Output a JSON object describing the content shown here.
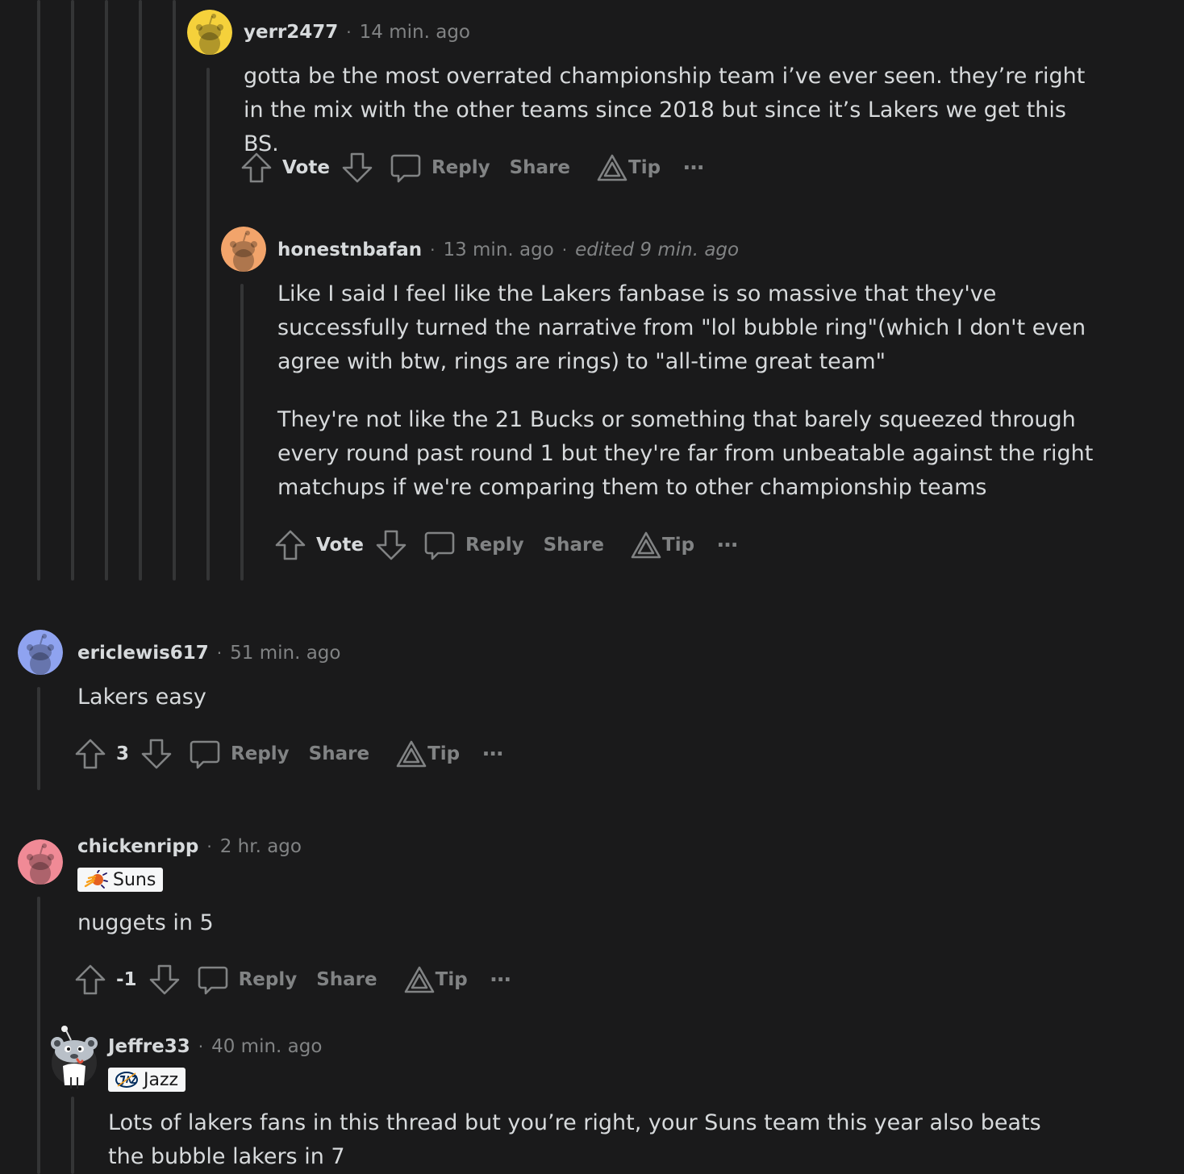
{
  "colors": {
    "background": "#1a1a1b",
    "thread_line": "#343536",
    "text": "#d7dadc",
    "meta_text": "#818384",
    "flair_bg": "#f6f7f8"
  },
  "comments": [
    {
      "username": "yerr2477",
      "time": "14 min. ago",
      "avatar_color": "#f5d13b",
      "paragraphs": [
        "gotta be the most overrated championship team i’ve ever seen. they’re right in the mix with the other teams since 2018 but since it’s Lakers we get this BS."
      ],
      "vote_label": "Vote"
    },
    {
      "username": "honestnbafan",
      "time": "13 min. ago",
      "edited": "edited 9 min. ago",
      "avatar_color": "#f2a46b",
      "paragraphs": [
        "Like I said I feel like the Lakers fanbase is so massive that they've successfully turned the narrative from \"lol bubble ring\"(which I don't even agree with btw, rings are rings) to \"all-time great team\"",
        "They're not like the 21 Bucks or something that barely squeezed through every round past round 1 but they're far from unbeatable against the right matchups if we're comparing them to other championship teams"
      ],
      "vote_label": "Vote"
    },
    {
      "username": "ericlewis617",
      "time": "51 min. ago",
      "avatar_color": "#8fa3f0",
      "paragraphs": [
        "Lakers easy"
      ],
      "vote_label": "3"
    },
    {
      "username": "chickenripp",
      "time": "2 hr. ago",
      "avatar_color": "#f08a96",
      "flair": "Suns",
      "flair_icon": "suns-logo-icon",
      "paragraphs": [
        "nuggets in 5"
      ],
      "vote_label": "-1"
    },
    {
      "username": "Jeffre33",
      "time": "40 min. ago",
      "avatar": "snoo-custom-avatar",
      "flair": "Jazz",
      "flair_icon": "jazz-logo-icon",
      "paragraphs": [
        "Lots of lakers fans in this thread but you’re right, your Suns team this year also beats the bubble lakers in 7"
      ]
    }
  ],
  "actions": {
    "reply": "Reply",
    "share": "Share",
    "tip": "Tip",
    "more": "…"
  }
}
